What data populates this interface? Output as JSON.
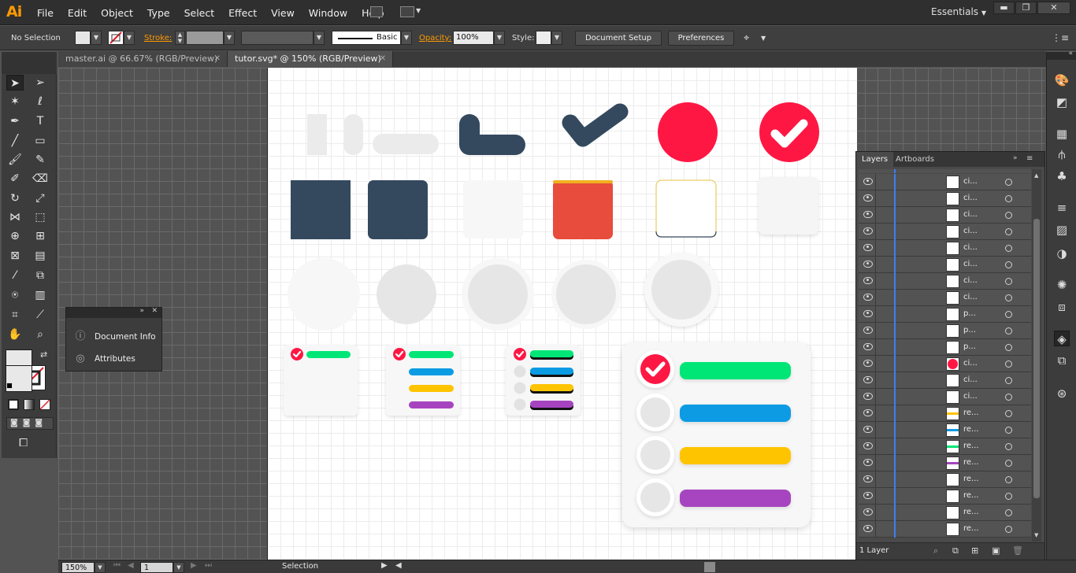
{
  "app": {
    "logo": "Ai"
  },
  "menu": [
    "File",
    "Edit",
    "Object",
    "Type",
    "Select",
    "Effect",
    "View",
    "Window",
    "Help"
  ],
  "workspace": "Essentials",
  "control": {
    "selection": "No Selection",
    "stroke_label": "Stroke:",
    "brush": "Basic",
    "opacity_label": "Opacity:",
    "opacity": "100%",
    "style_label": "Style:",
    "doc_setup": "Document Setup",
    "preferences": "Preferences"
  },
  "tabs": [
    {
      "label": "master.ai @ 66.67% (RGB/Preview)"
    },
    {
      "label": "tutor.svg* @ 150% (RGB/Preview)"
    }
  ],
  "doc_panel": {
    "items": [
      "Document Info",
      "Attributes"
    ]
  },
  "layers_panel": {
    "tabs": [
      "Layers",
      "Artboards"
    ],
    "footer": "1 Layer",
    "rows": [
      {
        "name": "ci..."
      },
      {
        "name": "ci..."
      },
      {
        "name": "ci..."
      },
      {
        "name": "ci..."
      },
      {
        "name": "ci..."
      },
      {
        "name": "ci..."
      },
      {
        "name": "ci..."
      },
      {
        "name": "ci..."
      },
      {
        "name": "p..."
      },
      {
        "name": "p..."
      },
      {
        "name": "p..."
      },
      {
        "name": "ci..."
      },
      {
        "name": "ci..."
      },
      {
        "name": "ci..."
      },
      {
        "name": "re..."
      },
      {
        "name": "re..."
      },
      {
        "name": "re..."
      },
      {
        "name": "re..."
      },
      {
        "name": "re..."
      },
      {
        "name": "re..."
      },
      {
        "name": "re..."
      },
      {
        "name": "re..."
      }
    ]
  },
  "status": {
    "zoom": "150%",
    "artboard": "1",
    "mode": "Selection"
  },
  "colors": {
    "navy": "#34495e",
    "red": "#ff1744",
    "orange_red": "#e74c3c",
    "green": "#00e676",
    "blue": "#0a9be3",
    "yellow": "#ffc400",
    "purple": "#a644bf",
    "light_gray": "#e6e6e6"
  }
}
